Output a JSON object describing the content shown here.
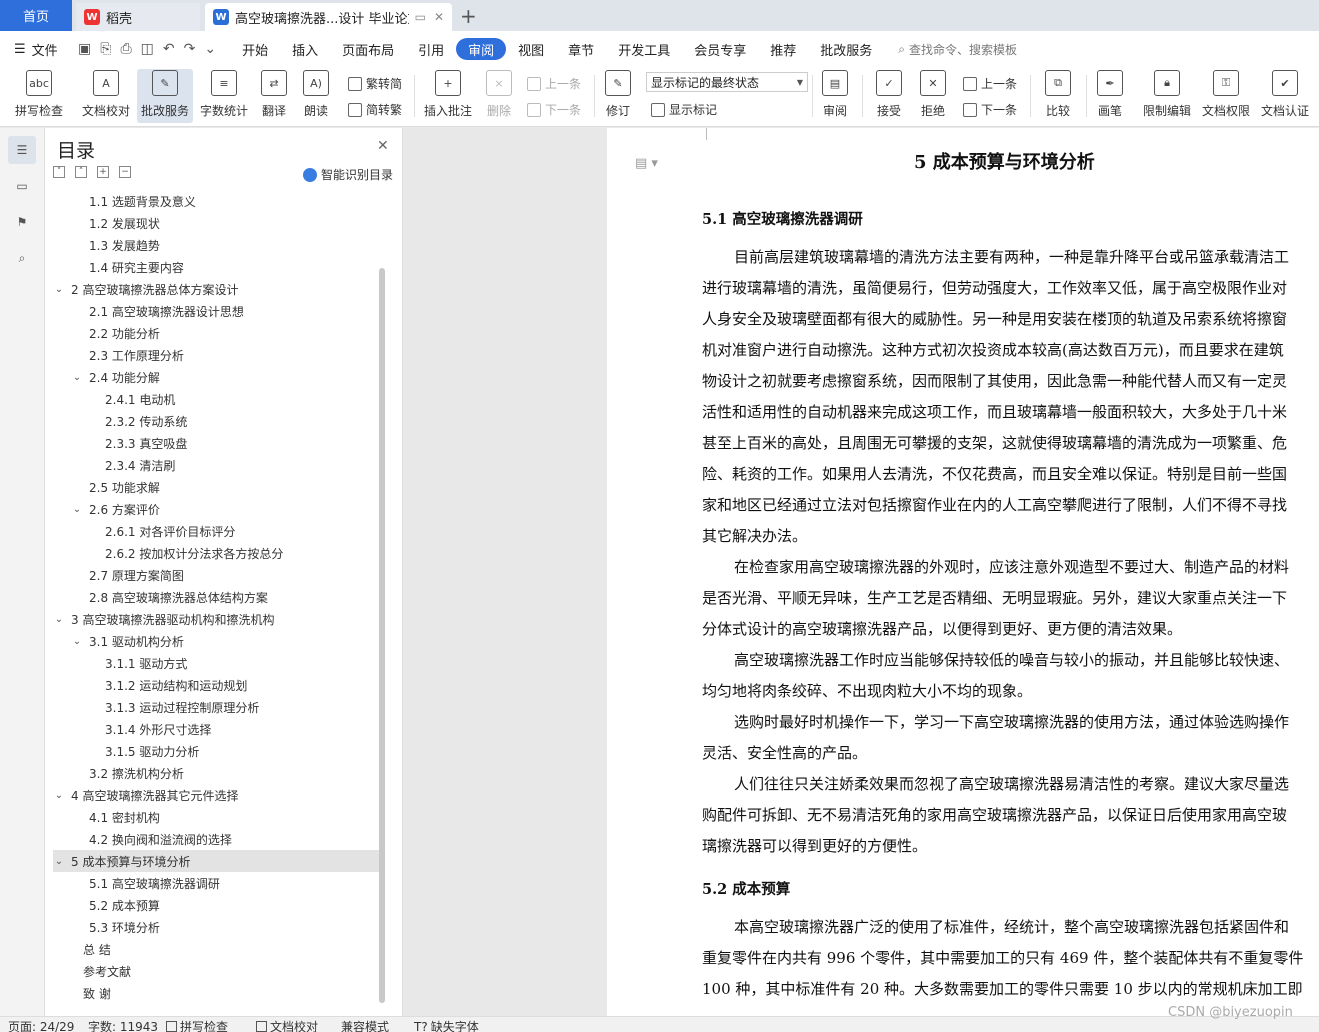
{
  "tabs": {
    "home": "首页",
    "daoke": "稻壳",
    "doc": "高空玻璃擦洗器...设计 毕业论文",
    "add": "+"
  },
  "menu": {
    "file": "文件",
    "items": [
      "开始",
      "插入",
      "页面布局",
      "引用",
      "审阅",
      "视图",
      "章节",
      "开发工具",
      "会员专享",
      "推荐",
      "批改服务"
    ],
    "active": "审阅",
    "search": "查找命令、搜索模板"
  },
  "ribbon": {
    "spellcheck": "拼写检查",
    "doccheck": "文档校对",
    "review_service": "批改服务",
    "wordcount": "字数统计",
    "translate": "翻译",
    "read": "朗读",
    "trad": "繁转简",
    "simp": "简转繁",
    "insert_comment": "插入批注",
    "delete": "删除",
    "prev": "上一条",
    "next": "下一条",
    "track": "修订",
    "markup_select": "显示标记的最终状态",
    "show_markup": "显示标记",
    "review": "审阅",
    "accept": "接受",
    "reject": "拒绝",
    "prev2": "上一条",
    "next2": "下一条",
    "compare": "比较",
    "pen": "画笔",
    "restrict": "限制编辑",
    "permission": "文档权限",
    "certify": "文档认证"
  },
  "toc": {
    "title": "目录",
    "ai_label": "智能识别目录",
    "items": [
      {
        "label": "1.1 选题背景及意义",
        "level": 2,
        "chev": ""
      },
      {
        "label": "1.2 发展现状",
        "level": 2,
        "chev": ""
      },
      {
        "label": "1.3 发展趋势",
        "level": 2,
        "chev": ""
      },
      {
        "label": "1.4 研究主要内容",
        "level": 2,
        "chev": ""
      },
      {
        "label": "2  高空玻璃擦洗器总体方案设计",
        "level": 1,
        "chev": "v"
      },
      {
        "label": "2.1  高空玻璃擦洗器设计思想",
        "level": 2,
        "chev": ""
      },
      {
        "label": "2.2 功能分析",
        "level": 2,
        "chev": ""
      },
      {
        "label": "2.3 工作原理分析",
        "level": 2,
        "chev": ""
      },
      {
        "label": "2.4 功能分解",
        "level": 2,
        "chev": "v"
      },
      {
        "label": "2.4.1 电动机",
        "level": 3,
        "chev": ""
      },
      {
        "label": "2.3.2 传动系统",
        "level": 3,
        "chev": ""
      },
      {
        "label": "2.3.3 真空吸盘",
        "level": 3,
        "chev": ""
      },
      {
        "label": "2.3.4  清洁刷",
        "level": 3,
        "chev": ""
      },
      {
        "label": "2.5 功能求解",
        "level": 2,
        "chev": ""
      },
      {
        "label": "2.6 方案评价",
        "level": 2,
        "chev": "v"
      },
      {
        "label": "2.6.1 对各评价目标评分",
        "level": 3,
        "chev": ""
      },
      {
        "label": "2.6.2 按加权计分法求各方按总分",
        "level": 3,
        "chev": ""
      },
      {
        "label": "2.7 原理方案简图",
        "level": 2,
        "chev": ""
      },
      {
        "label": "2.8  高空玻璃擦洗器总体结构方案",
        "level": 2,
        "chev": ""
      },
      {
        "label": "3  高空玻璃擦洗器驱动机构和擦洗机构",
        "level": 1,
        "chev": "v"
      },
      {
        "label": "3.1  驱动机构分析",
        "level": 2,
        "chev": "v"
      },
      {
        "label": "3.1.1  驱动方式",
        "level": 3,
        "chev": ""
      },
      {
        "label": "3.1.2 运动结构和运动规划",
        "level": 3,
        "chev": ""
      },
      {
        "label": "3.1.3 运动过程控制原理分析",
        "level": 3,
        "chev": ""
      },
      {
        "label": "3.1.4 外形尺寸选择",
        "level": 3,
        "chev": ""
      },
      {
        "label": "3.1.5 驱动力分析",
        "level": 3,
        "chev": ""
      },
      {
        "label": "3.2 擦洗机构分析",
        "level": 2,
        "chev": ""
      },
      {
        "label": "4  高空玻璃擦洗器其它元件选择",
        "level": 1,
        "chev": "v"
      },
      {
        "label": "4.1 密封机构",
        "level": 2,
        "chev": ""
      },
      {
        "label": "4.2 换向阀和溢流阀的选择",
        "level": 2,
        "chev": ""
      },
      {
        "label": "5  成本预算与环境分析",
        "level": 1,
        "chev": "v",
        "active": true
      },
      {
        "label": "5.1  高空玻璃擦洗器调研",
        "level": 2,
        "chev": ""
      },
      {
        "label": "5.2  成本预算",
        "level": 2,
        "chev": ""
      },
      {
        "label": "5.3  环境分析",
        "level": 2,
        "chev": ""
      },
      {
        "label": "总   结",
        "level": 0,
        "chev": ""
      },
      {
        "label": "参考文献",
        "level": 0,
        "chev": ""
      },
      {
        "label": "致   谢",
        "level": 0,
        "chev": ""
      }
    ]
  },
  "document": {
    "chapter_title": "5  成本预算与环境分析",
    "sec1_title": "5.1  高空玻璃擦洗器调研",
    "sec2_title": "5.2  成本预算",
    "lines": [
      {
        "text": "目前高层建筑玻璃幕墙的清洗方法主要有两种，一种是靠升降平台或吊篮承载清洁工",
        "indent": true
      },
      {
        "text": "进行玻璃幕墙的清洗，虽简便易行，但劳动强度大，工作效率又低，属于高空极限作业对",
        "indent": false
      },
      {
        "text": "人身安全及玻璃壁面都有很大的威胁性。另一种是用安装在楼顶的轨道及吊索系统将擦窗",
        "indent": false
      },
      {
        "text": "机对准窗户进行自动擦洗。这种方式初次投资成本较高(高达数百万元)，而且要求在建筑",
        "indent": false
      },
      {
        "text": "物设计之初就要考虑擦窗系统，因而限制了其使用，因此急需一种能代替人而又有一定灵",
        "indent": false
      },
      {
        "text": "活性和适用性的自动机器来完成这项工作，而且玻璃幕墙一般面积较大，大多处于几十米",
        "indent": false
      },
      {
        "text": "甚至上百米的高处，且周围无可攀援的支架，这就使得玻璃幕墙的清洗成为一项繁重、危",
        "indent": false
      },
      {
        "text": "险、耗资的工作。如果用人去清洗，不仅花费高，而且安全难以保证。特别是目前一些国",
        "indent": false
      },
      {
        "text": "家和地区已经通过立法对包括擦窗作业在内的人工高空攀爬进行了限制，人们不得不寻找",
        "indent": false
      },
      {
        "text": "其它解决办法。",
        "indent": false
      },
      {
        "text": "在检查家用高空玻璃擦洗器的外观时，应该注意外观造型不要过大、制造产品的材料",
        "indent": true
      },
      {
        "text": "是否光滑、平顺无异味，生产工艺是否精细、无明显瑕疵。另外，建议大家重点关注一下",
        "indent": false
      },
      {
        "text": "分体式设计的高空玻璃擦洗器产品，以便得到更好、更方便的清洁效果。",
        "indent": false
      },
      {
        "text": "高空玻璃擦洗器工作时应当能够保持较低的噪音与较小的振动，并且能够比较快速、",
        "indent": true
      },
      {
        "text": "均匀地将肉条绞碎、不出现肉粒大小不均的现象。",
        "indent": false
      },
      {
        "text": "选购时最好时机操作一下，学习一下高空玻璃擦洗器的使用方法，通过体验选购操作",
        "indent": true
      },
      {
        "text": "灵活、安全性高的产品。",
        "indent": false
      },
      {
        "text": "人们往往只关注娇柔效果而忽视了高空玻璃擦洗器易清洁性的考察。建议大家尽量选",
        "indent": true
      },
      {
        "text": "购配件可拆卸、无不易清洁死角的家用高空玻璃擦洗器产品，以保证日后使用家用高空玻",
        "indent": false
      },
      {
        "text": "璃擦洗器可以得到更好的方便性。",
        "indent": false
      }
    ],
    "lines2": [
      {
        "text": "本高空玻璃擦洗器广泛的使用了标准件，经统计，整个高空玻璃擦洗器包括紧固件和",
        "indent": true
      },
      {
        "text": "重复零件在内共有 996 个零件，其中需要加工的只有 469 件，整个装配体共有不重复零件",
        "indent": false
      },
      {
        "text": "100 种，其中标准件有 20 种。大多数需要加工的零件只需要 10 步以内的常规机床加工即",
        "indent": false
      }
    ]
  },
  "status": {
    "page": "页面: 24/29",
    "words": "字数: 11943",
    "spell": "拼写检查",
    "doccheck": "文档校对",
    "compat": "兼容模式",
    "missing_font": "缺失字体"
  },
  "watermark": "CSDN @biyezuopin"
}
